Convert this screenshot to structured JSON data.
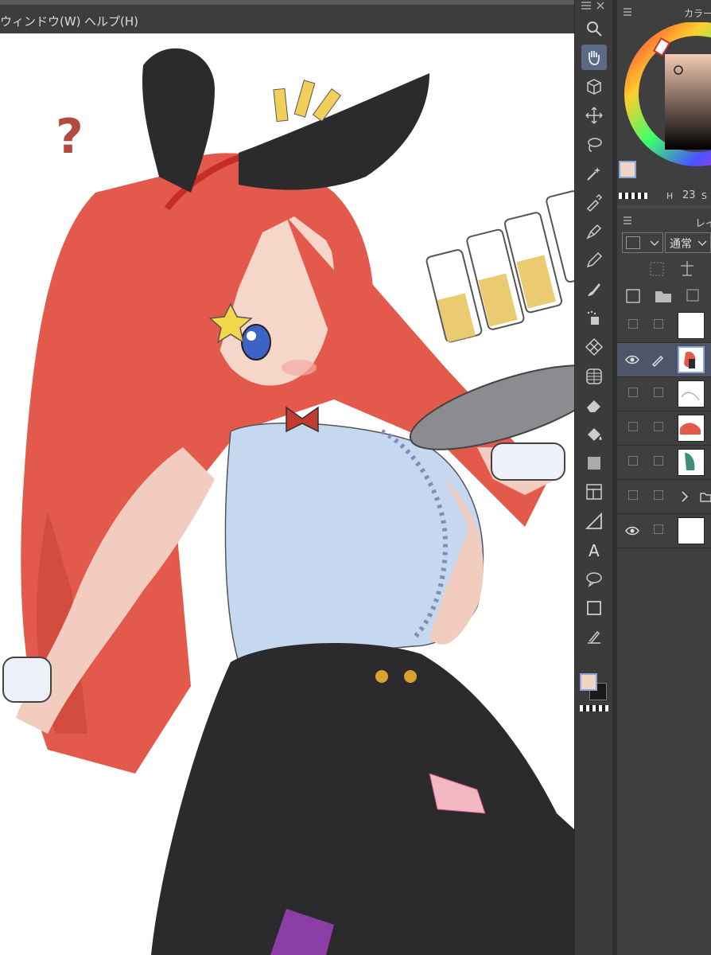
{
  "menubar": {
    "window_label": "ウィンドウ(W)",
    "help_label": "ヘルプ(H)"
  },
  "color_panel": {
    "title": "カラーサ",
    "size_value": "23",
    "size_h_label": "H",
    "size_s_label": "S"
  },
  "layer_panel": {
    "title": "レイ",
    "blend_mode": "通常"
  },
  "colors": {
    "main": "#f0d5c5",
    "sub": "#1a1a1a",
    "accent": "#5b6b86",
    "hair": "#e0554a"
  },
  "tools": [
    "search-icon",
    "hand-icon",
    "3d-object-icon",
    "move-icon",
    "lasso-icon",
    "magic-wand-icon",
    "eyedropper-icon",
    "pen-icon",
    "pencil-icon",
    "brush-icon",
    "airbrush-icon",
    "decoration-icon",
    "grid-icon",
    "eraser-icon",
    "fill-icon",
    "gradient-icon",
    "frame-icon",
    "ruler-icon",
    "text-icon",
    "balloon-icon",
    "shape-icon",
    "correction-icon"
  ]
}
